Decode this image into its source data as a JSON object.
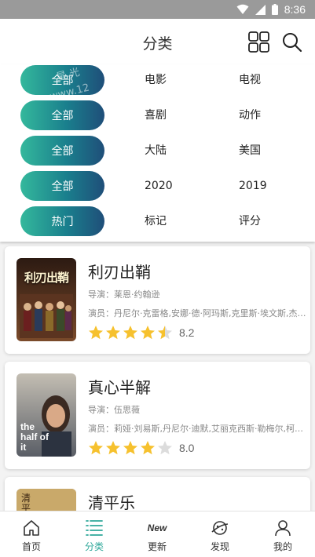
{
  "status_bar": {
    "time": "8:36"
  },
  "header": {
    "title": "分类"
  },
  "filters": {
    "rows": [
      {
        "pill": "全部",
        "options": [
          "电影",
          "电视"
        ]
      },
      {
        "pill": "全部",
        "options": [
          "喜剧",
          "动作"
        ]
      },
      {
        "pill": "全部",
        "options": [
          "大陆",
          "美国"
        ]
      },
      {
        "pill": "全部",
        "options": [
          "2020",
          "2019"
        ]
      },
      {
        "pill": "热门",
        "options": [
          "标记",
          "评分"
        ]
      }
    ],
    "watermark": "星光 www.12"
  },
  "movies": [
    {
      "title": "利刃出鞘",
      "director": "导演：莱恩·约翰逊",
      "cast": "演员：丹尼尔·克雷格,安娜·德·阿玛斯,克里斯·埃文斯,杰米·李·柯蒂斯",
      "rating": 4.5,
      "score": "8.2",
      "poster_text": "利刃出鞘",
      "poster_colors": [
        "#3a2418",
        "#7a4a2a"
      ]
    },
    {
      "title": "真心半解",
      "director": "导演：伍思薇",
      "cast": "演员：莉娅·刘易斯,丹尼尔·迪默,艾丽克西斯·勒梅尔,柯林斯·佩尼",
      "rating": 4,
      "score": "8.0",
      "poster_text": "the half of it",
      "poster_colors": [
        "#b8b2a8",
        "#5a5e66"
      ]
    },
    {
      "title": "清平乐",
      "director": "",
      "cast": "",
      "rating": 0,
      "score": "",
      "poster_text": "清平乐",
      "poster_colors": [
        "#8c6a3c",
        "#c9a96a"
      ]
    }
  ],
  "tabbar": {
    "active_color": "#2fa89a",
    "tabs": [
      {
        "label": "首页",
        "icon": "home-icon"
      },
      {
        "label": "分类",
        "icon": "list-icon"
      },
      {
        "label": "更新",
        "icon": "new-icon",
        "icon_text": "New"
      },
      {
        "label": "发现",
        "icon": "planet-icon"
      },
      {
        "label": "我的",
        "icon": "user-icon"
      }
    ]
  }
}
